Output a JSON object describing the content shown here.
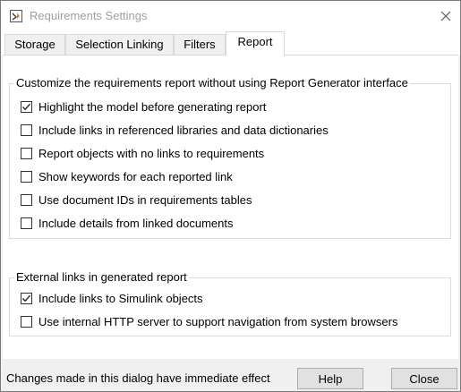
{
  "window": {
    "title": "Requirements Settings"
  },
  "tabs": [
    {
      "label": "Storage",
      "active": false
    },
    {
      "label": "Selection Linking",
      "active": false
    },
    {
      "label": "Filters",
      "active": false
    },
    {
      "label": "Report",
      "active": true
    }
  ],
  "report_group": {
    "legend": "Customize the requirements report without using Report Generator interface",
    "options": [
      {
        "label": "Highlight the model before generating report",
        "checked": true
      },
      {
        "label": "Include links in referenced libraries and data dictionaries",
        "checked": false
      },
      {
        "label": "Report objects with no links to requirements",
        "checked": false
      },
      {
        "label": "Show keywords for each reported link",
        "checked": false
      },
      {
        "label": "Use document IDs in requirements tables",
        "checked": false
      },
      {
        "label": "Include details from linked documents",
        "checked": false
      }
    ]
  },
  "external_group": {
    "legend": "External links in generated report",
    "options": [
      {
        "label": "Include links to Simulink objects",
        "checked": true
      },
      {
        "label": "Use internal HTTP server to support navigation from system browsers",
        "checked": false
      }
    ]
  },
  "footer": {
    "status": "Changes made in this dialog have immediate effect",
    "help_label": "Help",
    "close_label": "Close"
  },
  "icons": {
    "app": "requirements-app-icon",
    "close": "close-icon",
    "checkmark": "checkmark-icon"
  }
}
